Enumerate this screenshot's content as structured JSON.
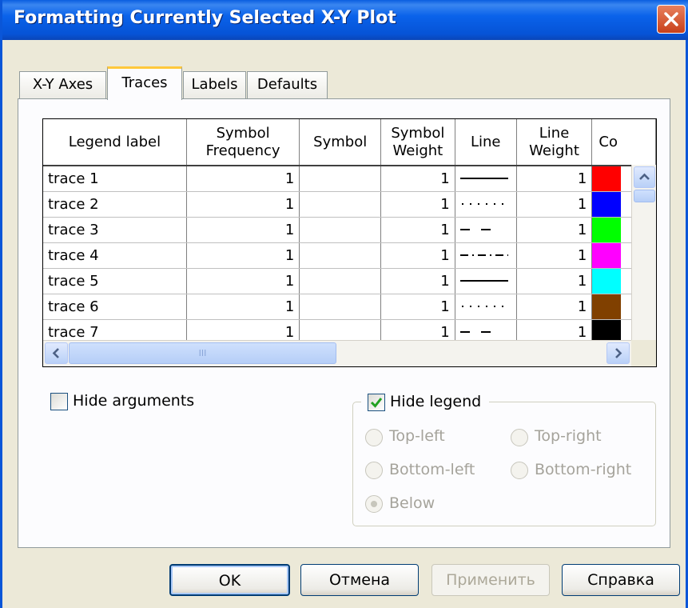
{
  "window": {
    "title": "Formatting Currently Selected X-Y Plot"
  },
  "tabs": [
    {
      "label": "X-Y Axes",
      "active": false
    },
    {
      "label": "Traces",
      "active": true
    },
    {
      "label": "Labels",
      "active": false
    },
    {
      "label": "Defaults",
      "active": false
    }
  ],
  "table": {
    "headers": {
      "legend_label": "Legend label",
      "symbol_frequency_1": "Symbol",
      "symbol_frequency_2": "Frequency",
      "symbol": "Symbol",
      "symbol_weight_1": "Symbol",
      "symbol_weight_2": "Weight",
      "line": "Line",
      "line_weight_1": "Line",
      "line_weight_2": "Weight",
      "color": "Co"
    },
    "rows": [
      {
        "label": "trace 1",
        "symbol_frequency": "1",
        "symbol": "",
        "symbol_weight": "1",
        "line_style": "solid",
        "line_weight": "1",
        "color": "#ff0000"
      },
      {
        "label": "trace 2",
        "symbol_frequency": "1",
        "symbol": "",
        "symbol_weight": "1",
        "line_style": "dot",
        "line_weight": "1",
        "color": "#0000ff"
      },
      {
        "label": "trace 3",
        "symbol_frequency": "1",
        "symbol": "",
        "symbol_weight": "1",
        "line_style": "dash",
        "line_weight": "1",
        "color": "#00ff00"
      },
      {
        "label": "trace 4",
        "symbol_frequency": "1",
        "symbol": "",
        "symbol_weight": "1",
        "line_style": "dashdot",
        "line_weight": "1",
        "color": "#ff00ff"
      },
      {
        "label": "trace 5",
        "symbol_frequency": "1",
        "symbol": "",
        "symbol_weight": "1",
        "line_style": "solid",
        "line_weight": "1",
        "color": "#00ffff"
      },
      {
        "label": "trace 6",
        "symbol_frequency": "1",
        "symbol": "",
        "symbol_weight": "1",
        "line_style": "dot",
        "line_weight": "1",
        "color": "#804000"
      },
      {
        "label": "trace 7",
        "symbol_frequency": "1",
        "symbol": "",
        "symbol_weight": "1",
        "line_style": "dash",
        "line_weight": "1",
        "color": "#000000"
      }
    ]
  },
  "options": {
    "hide_arguments": {
      "label": "Hide arguments",
      "checked": false
    },
    "hide_legend": {
      "label": "Hide legend",
      "checked": true
    },
    "legend_positions": [
      {
        "label": "Top-left",
        "selected": false
      },
      {
        "label": "Top-right",
        "selected": false
      },
      {
        "label": "Bottom-left",
        "selected": false
      },
      {
        "label": "Bottom-right",
        "selected": false
      },
      {
        "label": "Below",
        "selected": true
      }
    ]
  },
  "buttons": {
    "ok": "OK",
    "cancel": "Отмена",
    "apply": "Применить",
    "help": "Справка"
  },
  "scrollbars": {
    "h_thumb_grip": "III"
  }
}
